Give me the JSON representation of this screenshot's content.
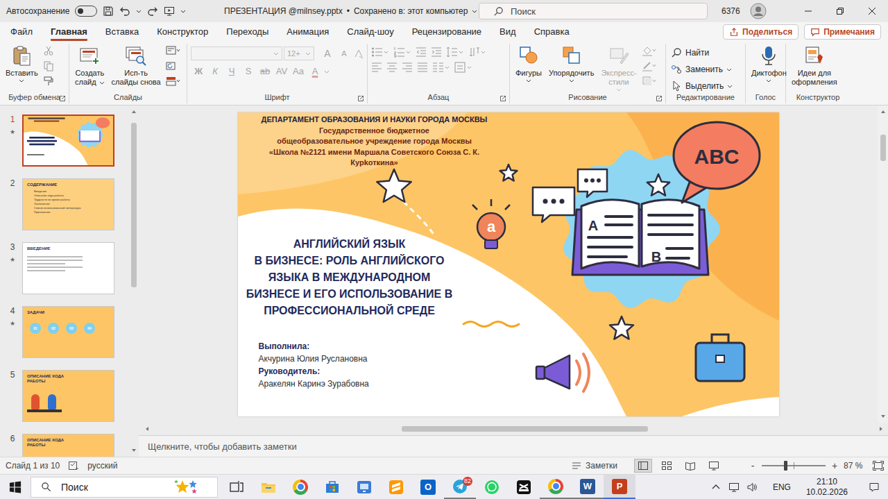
{
  "titlebar": {
    "autosave": {
      "label": "Автосохранение",
      "on": false
    },
    "file_name": "ПРЕЗЕНТАЦИЯ @milnsey.pptx",
    "separator": "•",
    "save_status": "Сохранено в: этот компьютер",
    "search": {
      "placeholder": "Поиск"
    },
    "account": "6376"
  },
  "menu_tabs": [
    {
      "label": "Файл",
      "selected": false
    },
    {
      "label": "Главная",
      "selected": true
    },
    {
      "label": "Вставка",
      "selected": false
    },
    {
      "label": "Конструктор",
      "selected": false
    },
    {
      "label": "Переходы",
      "selected": false
    },
    {
      "label": "Анимация",
      "selected": false
    },
    {
      "label": "Слайд-шоу",
      "selected": false
    },
    {
      "label": "Рецензирование",
      "selected": false
    },
    {
      "label": "Вид",
      "selected": false
    },
    {
      "label": "Справка",
      "selected": false
    }
  ],
  "share_button": {
    "label": "Поделиться"
  },
  "comments_button": {
    "label": "Примечания"
  },
  "ribbon": {
    "clipboard": {
      "label": "Буфер обмена",
      "paste": {
        "label": "Вставить",
        "dropdown": true
      }
    },
    "slides": {
      "label": "Слайды",
      "buttons": [
        {
          "label_lines": [
            "Создать",
            "слайд"
          ],
          "kind": "new",
          "dropdown": true
        },
        {
          "label_lines": [
            "Исп-ть",
            "слайды снова"
          ],
          "kind": "reuse",
          "dropdown": false
        }
      ]
    },
    "font": {
      "label": "Шрифт",
      "disabled": true,
      "font_name": "",
      "font_size": "12+",
      "size_buttons": [
        {
          "label": "A",
          "kind": "grow"
        },
        {
          "label": "A",
          "kind": "shrink"
        }
      ],
      "format_buttons": [
        {
          "label": "Ж",
          "kind": "bold"
        },
        {
          "label": "К",
          "kind": "italic"
        },
        {
          "label": "Ч",
          "kind": "underline"
        },
        {
          "label": "S",
          "kind": "shadow"
        },
        {
          "label": "ab",
          "kind": "strike"
        },
        {
          "label": "AV",
          "kind": "spacing"
        },
        {
          "label": "Aa",
          "kind": "case"
        },
        {
          "label": "A",
          "kind": "color"
        }
      ]
    },
    "paragraph": {
      "label": "Абзац",
      "disabled": true
    },
    "drawing": {
      "label": "Рисование",
      "buttons": [
        {
          "label_lines": [
            "Фигуры"
          ],
          "kind": "shapes",
          "disabled": false
        },
        {
          "label_lines": [
            "Упорядочить"
          ],
          "kind": "arrange",
          "disabled": false
        },
        {
          "label_lines": [
            "Экспресс-",
            "стили"
          ],
          "kind": "styles",
          "disabled": true
        }
      ]
    },
    "editing": {
      "label": "Редактирование",
      "buttons": [
        {
          "label": "Найти",
          "kind": "find",
          "dropdown": false
        },
        {
          "label": "Заменить",
          "kind": "replace",
          "dropdown": true
        },
        {
          "label": "Выделить",
          "kind": "select",
          "dropdown": true
        }
      ]
    },
    "voice": {
      "label": "Голос",
      "button": {
        "label": "Диктофон",
        "dropdown": true
      }
    },
    "designer": {
      "label": "Конструктор",
      "button": {
        "label_lines": [
          "Идеи для",
          "оформления"
        ]
      }
    }
  },
  "thumbnails_pane": {
    "transition_mark": "★",
    "items": [
      {
        "number": "1",
        "animated": true,
        "selected": true,
        "kind": "title",
        "heading": "",
        "items": []
      },
      {
        "number": "2",
        "animated": false,
        "selected": false,
        "kind": "contents",
        "heading": "СОДЕРЖАНИЕ",
        "items": [
          "Введение",
          "Описание хода работы",
          "Трудности во время работы",
          "Заключение",
          "Список использованной литературы",
          "Приложение"
        ]
      },
      {
        "number": "3",
        "animated": true,
        "selected": false,
        "kind": "intro",
        "heading": "ВВЕДЕНИЕ",
        "items": []
      },
      {
        "number": "4",
        "animated": true,
        "selected": false,
        "kind": "tasks",
        "heading": "ЗАДАЧИ",
        "items": [
          "01",
          "02",
          "03",
          "04"
        ]
      },
      {
        "number": "5",
        "animated": false,
        "selected": false,
        "kind": "process",
        "heading": "ОПИСАНИЕ ХОДА РАБОТЫ",
        "items": []
      },
      {
        "number": "6",
        "animated": false,
        "selected": false,
        "kind": "process",
        "heading": "ОПИСАНИЕ ХОДА РАБОТЫ",
        "items": []
      }
    ]
  },
  "slide": {
    "header_lines": [
      {
        "text": "ДЕПАРТАМЕНТ ОБРАЗОВАНИЯ И НАУКИ ГОРОДА МОСКВЫ",
        "color": "#1c1f3f"
      },
      {
        "text": "Государственное бюджетное",
        "color": "#6e2611"
      },
      {
        "text": "общеобразовательное учреждение города Москвы",
        "color": "#6e2611"
      },
      {
        "text": "«Школа №2121 имени Маршала Советского Союза С. К.",
        "color": "#6e2611"
      },
      {
        "text": "Курkоткина»",
        "color": "#6e2611"
      }
    ],
    "title_lines": [
      "АНГЛИЙСКИЙ ЯЗЫК",
      "В БИЗНЕСЕ: РОЛЬ АНГЛИЙСКОГО",
      "ЯЗЫКА В МЕЖДУНАРОДНОМ",
      "БИЗНЕСЕ И ЕГО ИСПОЛЬЗОВАНИЕ В",
      "ПРОФЕССИОНАЛЬНОЙ СРЕДЕ"
    ],
    "credits": [
      {
        "text": "Выполнила:",
        "kind": "label"
      },
      {
        "text": "Акчурина Юлия Руслановна",
        "kind": "name"
      },
      {
        "text": "Руководитель:",
        "kind": "label"
      },
      {
        "text": "Аракелян Каринэ Зурабовна",
        "kind": "name"
      }
    ],
    "art": {
      "bubble": "ABC",
      "book_left": "A",
      "book_right": "B",
      "bulb": "a"
    }
  },
  "scrollbars": {
    "thumbnails": {
      "start": 0.02,
      "size": 0.5
    },
    "slide_vertical": {
      "start": 0.06,
      "size": 0.09
    },
    "slide_horizontal": {
      "start": 0.345,
      "size": 0.34
    }
  },
  "notes": {
    "placeholder": "Щелкните, чтобы добавить заметки"
  },
  "status_bar": {
    "slide_info": "Слайд 1 из 10",
    "language": "русский",
    "notes_button": "Заметки",
    "views": [
      {
        "kind": "normal",
        "selected": true
      },
      {
        "kind": "sorter",
        "selected": false
      },
      {
        "kind": "reading",
        "selected": false
      },
      {
        "kind": "slideshow",
        "selected": false
      }
    ],
    "zoom": {
      "minus": "-",
      "plus": "+",
      "level": 0.38,
      "value": "87 %"
    }
  },
  "taskbar": {
    "search_placeholder": "Поиск",
    "apps": [
      {
        "kind": "task-view",
        "glyph": "",
        "running": false,
        "active": false,
        "badge": ""
      },
      {
        "kind": "explorer",
        "glyph": "",
        "running": false,
        "active": false,
        "badge": ""
      },
      {
        "kind": "chrome",
        "glyph": "",
        "running": false,
        "active": false,
        "badge": ""
      },
      {
        "kind": "store",
        "glyph": "",
        "running": false,
        "active": false,
        "badge": ""
      },
      {
        "kind": "remote",
        "glyph": "",
        "running": false,
        "active": false,
        "badge": ""
      },
      {
        "kind": "sublime",
        "glyph": "",
        "running": false,
        "active": false,
        "badge": ""
      },
      {
        "kind": "outlook",
        "glyph": "O",
        "running": false,
        "active": false,
        "badge": ""
      },
      {
        "kind": "telegram",
        "glyph": "",
        "running": true,
        "active": false,
        "badge": "82"
      },
      {
        "kind": "whatsapp",
        "glyph": "",
        "running": false,
        "active": false,
        "badge": ""
      },
      {
        "kind": "capcut",
        "glyph": "",
        "running": false,
        "active": false,
        "badge": ""
      },
      {
        "kind": "chrome",
        "glyph": "",
        "running": true,
        "active": false,
        "badge": ""
      },
      {
        "kind": "word",
        "glyph": "W",
        "running": true,
        "active": false,
        "badge": ""
      },
      {
        "kind": "powerpoint",
        "glyph": "P",
        "running": true,
        "active": true,
        "badge": ""
      }
    ],
    "language": "ENG",
    "time": "21:10",
    "date": "10.02.2026"
  }
}
